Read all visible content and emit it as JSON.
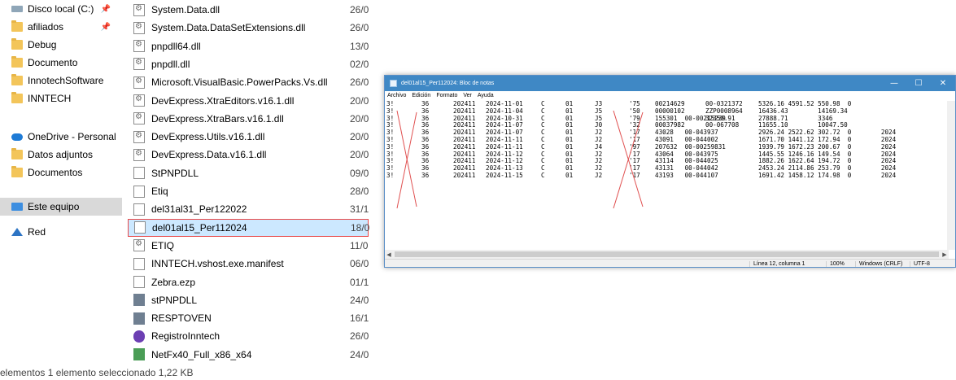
{
  "explorer": {
    "nav": [
      {
        "label": "Disco local (C:)",
        "icon": "drive-icon",
        "pinned": true
      },
      {
        "label": "afiliados",
        "icon": "folder-icon",
        "pinned": true
      },
      {
        "label": "Debug",
        "icon": "folder-icon"
      },
      {
        "label": "Documento",
        "icon": "folder-icon"
      },
      {
        "label": "InnotechSoftware",
        "icon": "folder-icon"
      },
      {
        "label": "INNTECH",
        "icon": "folder-icon"
      },
      {
        "label": "OneDrive - Personal",
        "icon": "cloud-icon"
      },
      {
        "label": "Datos adjuntos",
        "icon": "folder-icon"
      },
      {
        "label": "Documentos",
        "icon": "folder-icon"
      },
      {
        "label": "Este equipo",
        "icon": "pc-icon",
        "selected": true
      },
      {
        "label": "Red",
        "icon": "network-icon"
      }
    ],
    "pin_glyph": "📌",
    "files": [
      {
        "name": "System.Data.dll",
        "date": "26/0",
        "icon": "dll"
      },
      {
        "name": "System.Data.DataSetExtensions.dll",
        "date": "26/0",
        "icon": "dll"
      },
      {
        "name": "pnpdll64.dll",
        "date": "13/0",
        "icon": "dll"
      },
      {
        "name": "pnpdll.dll",
        "date": "02/0",
        "icon": "dll"
      },
      {
        "name": "Microsoft.VisualBasic.PowerPacks.Vs.dll",
        "date": "26/0",
        "icon": "dll"
      },
      {
        "name": "DevExpress.XtraEditors.v16.1.dll",
        "date": "20/0",
        "icon": "dll"
      },
      {
        "name": "DevExpress.XtraBars.v16.1.dll",
        "date": "20/0",
        "icon": "dll"
      },
      {
        "name": "DevExpress.Utils.v16.1.dll",
        "date": "20/0",
        "icon": "dll"
      },
      {
        "name": "DevExpress.Data.v16.1.dll",
        "date": "20/0",
        "icon": "dll"
      },
      {
        "name": "StPNPDLL",
        "date": "09/0",
        "icon": "doc"
      },
      {
        "name": "Etiq",
        "date": "28/0",
        "icon": "doc"
      },
      {
        "name": "del31al31_Per122022",
        "date": "31/1",
        "icon": "doc"
      },
      {
        "name": "del01al15_Per112024",
        "date": "18/0",
        "icon": "doc",
        "selected": true
      },
      {
        "name": "ETIQ",
        "date": "11/0",
        "icon": "dll"
      },
      {
        "name": "INNTECH.vshost.exe.manifest",
        "date": "06/0",
        "icon": "doc"
      },
      {
        "name": "Zebra.ezp",
        "date": "01/1",
        "icon": "doc"
      },
      {
        "name": "stPNPDLL",
        "date": "24/0",
        "icon": "exe"
      },
      {
        "name": "RESPTOVEN",
        "date": "16/1",
        "icon": "exe"
      },
      {
        "name": "RegistroInntech",
        "date": "26/0",
        "icon": "app"
      },
      {
        "name": "NetFx40_Full_x86_x64",
        "date": "24/0",
        "icon": "setup"
      }
    ],
    "status_text": "elementos    1 elemento seleccionado  1,22 KB"
  },
  "notepad": {
    "title": "del01al15_Per112024: Bloc de notas",
    "controls": {
      "minimize": "—",
      "maximize": "☐",
      "close": "✕"
    },
    "menu": [
      "Archivo",
      "Edición",
      "Formato",
      "Ver",
      "Ayuda"
    ],
    "lines": [
      [
        "3!",
        "36",
        "202411",
        "2024-11-01",
        "C",
        "01",
        "J3",
        "'75",
        "00214629",
        "00-0321372",
        "5326.16 4591.52 550.98  0"
      ],
      [
        "3!",
        "36",
        "202411",
        "2024-11-04",
        "C",
        "01",
        "J5",
        "'50",
        "00000102",
        "ZZP0008964",
        "16436.43        14169.34"
      ],
      [
        "3!",
        "36",
        "202411",
        "2024-10-31",
        "C",
        "01",
        "J5",
        "'79",
        "155301  00-00215239",
        "32350.91",
        "27888.71        3346"
      ],
      [
        "3!",
        "36",
        "202411",
        "2024-11-07",
        "C",
        "01",
        "J0",
        "'32",
        "00037982",
        "00-067708",
        "11655.10        10047.50"
      ],
      [
        "3!",
        "36",
        "202411",
        "2024-11-07",
        "C",
        "01",
        "J2",
        "'17",
        "43028   00-043937",
        "",
        "2926.24 2522.62 302.72  0        2024"
      ],
      [
        "3!",
        "36",
        "202411",
        "2024-11-11",
        "C",
        "01",
        "J2",
        "'17",
        "43091   00-044002",
        "",
        "1671.70 1441.12 172.94  0        2024"
      ],
      [
        "3!",
        "36",
        "202411",
        "2024-11-11",
        "C",
        "01",
        "J4",
        "'97",
        "207632  00-00259831",
        "",
        "1939.79 1672.23 200.67  0        2024"
      ],
      [
        "3!",
        "36",
        "202411",
        "2024-11-12",
        "C",
        "01",
        "J2",
        "'17",
        "43064   00-043975",
        "",
        "1445.55 1246.16 149.54  0        2024"
      ],
      [
        "3!",
        "36",
        "202411",
        "2024-11-12",
        "C",
        "01",
        "J2",
        "'17",
        "43114   00-044025",
        "",
        "1882.26 1622.64 194.72  0        2024"
      ],
      [
        "3!",
        "36",
        "202411",
        "2024-11-13",
        "C",
        "01",
        "J2",
        "'17",
        "43131   00-044042",
        "",
        "2453.24 2114.86 253.79  0        2024"
      ],
      [
        "3!",
        "36",
        "202411",
        "2024-11-15",
        "C",
        "01",
        "J2",
        "'17",
        "43193   00-044107",
        "",
        "1691.42 1458.12 174.98  0        2024"
      ]
    ],
    "status": {
      "position": "Línea 12, columna 1",
      "zoom": "100%",
      "line_ending": "Windows (CRLF)",
      "encoding": "UTF-8"
    }
  }
}
